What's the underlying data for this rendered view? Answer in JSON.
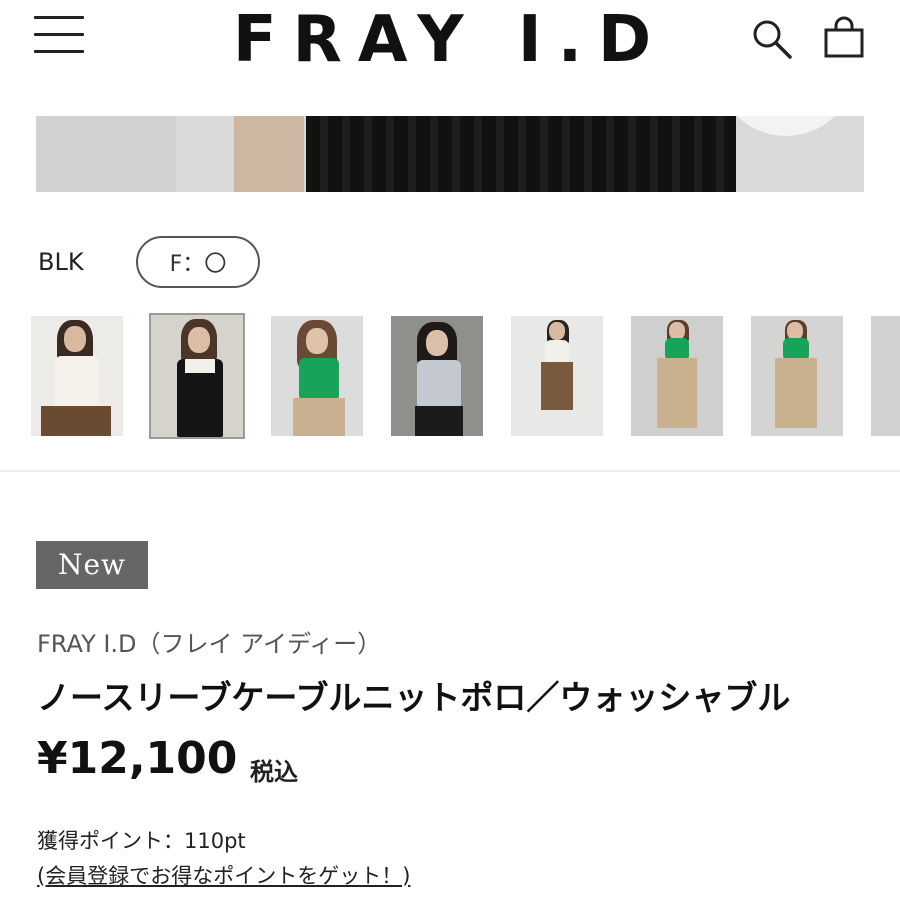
{
  "header": {
    "logo": "FRAY I.D"
  },
  "icons": {
    "menu": "hamburger-menu-icon",
    "search": "search-icon",
    "cart": "shopping-bag-icon"
  },
  "variant": {
    "color_label": "BLK",
    "size_chip": "F：〇"
  },
  "thumbnails": [
    {
      "label": "white knit polo with brown skirt",
      "selected": false
    },
    {
      "label": "black knit polo with white collar",
      "selected": true
    },
    {
      "label": "green knit polo with beige pants",
      "selected": false
    },
    {
      "label": "light gray knit polo with black skirt",
      "selected": false
    },
    {
      "label": "white knit polo with brown skirt full length",
      "selected": false
    },
    {
      "label": "green knit polo with beige long skirt",
      "selected": false
    },
    {
      "label": "green knit polo with beige long skirt back",
      "selected": false
    }
  ],
  "product": {
    "badge": "New",
    "brand": "FRAY I.D（フレイ アイディー）",
    "title": "ノースリーブケーブルニットポロ／ウォッシャブル",
    "price": "¥12,100",
    "tax_label": "税込",
    "points": "獲得ポイント：110pt",
    "register_link": "(会員登録でお得なポイントをゲット！)"
  },
  "colors": {
    "badge_bg": "#666666",
    "text": "#111111",
    "divider": "#ececec"
  }
}
